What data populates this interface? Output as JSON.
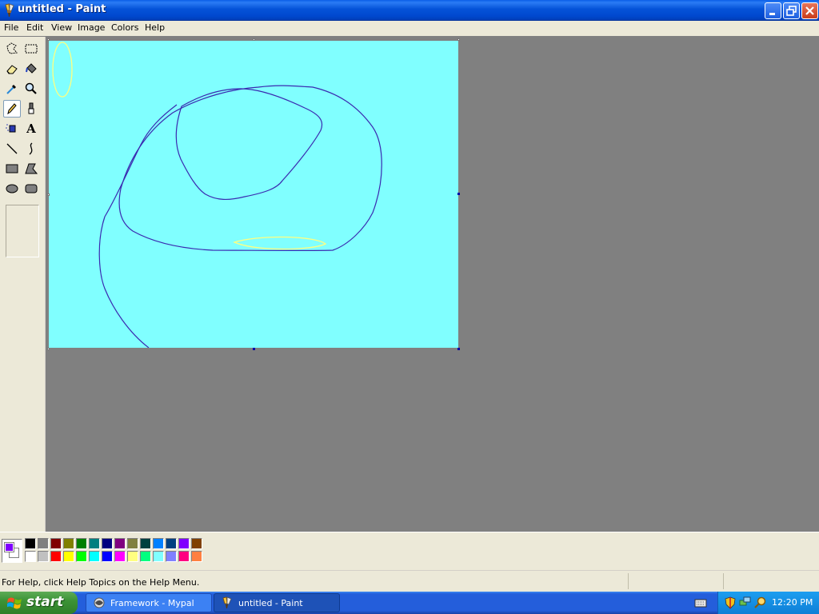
{
  "window": {
    "title": "untitled - Paint"
  },
  "menu": [
    "File",
    "Edit",
    "View",
    "Image",
    "Colors",
    "Help"
  ],
  "tools": [
    {
      "name": "free-form-select-icon"
    },
    {
      "name": "rect-select-icon"
    },
    {
      "name": "eraser-icon"
    },
    {
      "name": "fill-bucket-icon"
    },
    {
      "name": "color-picker-icon"
    },
    {
      "name": "magnifier-icon"
    },
    {
      "name": "pencil-icon"
    },
    {
      "name": "brush-icon"
    },
    {
      "name": "airbrush-icon"
    },
    {
      "name": "text-icon"
    },
    {
      "name": "line-icon"
    },
    {
      "name": "curve-icon"
    },
    {
      "name": "rectangle-icon"
    },
    {
      "name": "polygon-icon"
    },
    {
      "name": "ellipse-icon"
    },
    {
      "name": "rounded-rect-icon"
    }
  ],
  "text_tool_glyph": "A",
  "active_tool": "pencil",
  "canvas": {
    "background": "#80ffff",
    "stroke_color": "#3a2ab0",
    "accent_color": "#ffff80"
  },
  "colors": {
    "foreground": "#8000ff",
    "background": "#ffffff",
    "palette_row1": [
      "#000000",
      "#808080",
      "#800000",
      "#808000",
      "#008000",
      "#008080",
      "#000080",
      "#800080",
      "#808040",
      "#004040",
      "#0080ff",
      "#004080",
      "#8000ff",
      "#804000"
    ],
    "palette_row2": [
      "#ffffff",
      "#c0c0c0",
      "#ff0000",
      "#ffff00",
      "#00ff00",
      "#00ffff",
      "#0000ff",
      "#ff00ff",
      "#ffff80",
      "#00ff80",
      "#80ffff",
      "#8080ff",
      "#ff0080",
      "#ff8040"
    ]
  },
  "status": {
    "help_text": "For Help, click Help Topics on the Help Menu."
  },
  "taskbar": {
    "start_label": "start",
    "tasks": [
      {
        "label": "Framework - Mypal",
        "active": false
      },
      {
        "label": "untitled - Paint",
        "active": true
      }
    ],
    "clock": "12:20 PM"
  }
}
